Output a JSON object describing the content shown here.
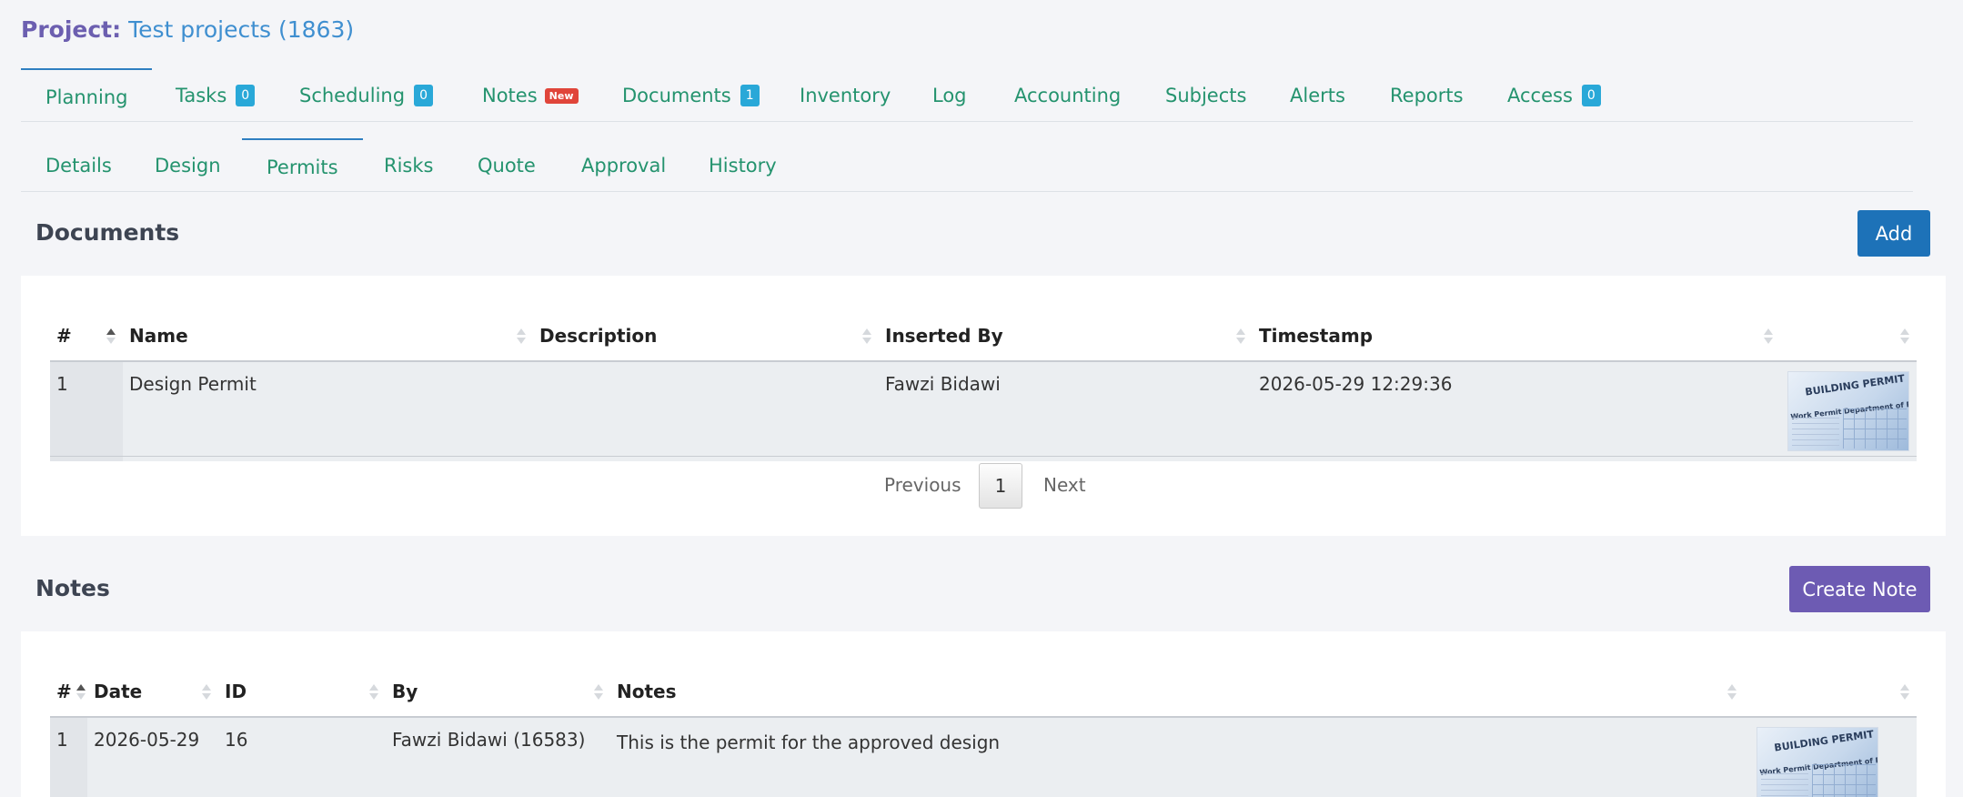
{
  "project": {
    "label": "Project:",
    "name": "Test projects (1863)"
  },
  "main_tabs": [
    {
      "label": "Planning",
      "active": true
    },
    {
      "label": "Tasks",
      "count": "0"
    },
    {
      "label": "Scheduling",
      "count": "0"
    },
    {
      "label": "Notes",
      "badge": "New"
    },
    {
      "label": "Documents",
      "count": "1"
    },
    {
      "label": "Inventory"
    },
    {
      "label": "Log"
    },
    {
      "label": "Accounting"
    },
    {
      "label": "Subjects"
    },
    {
      "label": "Alerts"
    },
    {
      "label": "Reports"
    },
    {
      "label": "Access",
      "count": "0"
    }
  ],
  "sub_tabs": [
    {
      "label": "Details"
    },
    {
      "label": "Design"
    },
    {
      "label": "Permits",
      "active": true
    },
    {
      "label": "Risks"
    },
    {
      "label": "Quote"
    },
    {
      "label": "Approval"
    },
    {
      "label": "History"
    }
  ],
  "documents": {
    "title": "Documents",
    "add_label": "Add",
    "columns": [
      "#",
      "Name",
      "Description",
      "Inserted By",
      "Timestamp",
      ""
    ],
    "rows": [
      {
        "num": "1",
        "name": "Design Permit",
        "description": "",
        "inserted_by": "Fawzi Bidawi",
        "timestamp": "2026-05-29 12:29:36",
        "thumb_title": "BUILDING PERMIT",
        "thumb_sub": "Work Permit Department of Buildings"
      }
    ],
    "pager": {
      "prev": "Previous",
      "page": "1",
      "next": "Next"
    }
  },
  "notes": {
    "title": "Notes",
    "create_label": "Create Note",
    "columns": [
      "#",
      "Date",
      "ID",
      "By",
      "Notes",
      ""
    ],
    "rows": [
      {
        "num": "1",
        "date": "2026-05-29",
        "id": "16",
        "by": "Fawzi Bidawi (16583)",
        "notes": "This is the permit for the approved design",
        "thumb_title": "BUILDING PERMIT",
        "thumb_sub": "Work Permit Department of Buildings"
      }
    ]
  },
  "colors": {
    "tab_text": "#24936e",
    "active_underline": "#2f7fc1",
    "count_badge": "#29a8d8",
    "new_badge": "#e0453a",
    "add_button": "#1d72b8",
    "create_note_button": "#6d5bb3"
  }
}
